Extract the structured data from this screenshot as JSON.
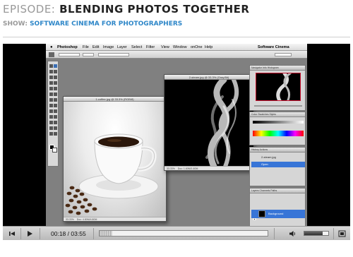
{
  "header": {
    "episode_prefix": "EPISODE:",
    "episode_title": "BLENDING PHOTOS TOGETHER",
    "show_prefix": "SHOW:",
    "show_title": "SOFTWARE CINEMA FOR PHOTOGRAPHERS"
  },
  "video": {
    "menubar": {
      "apple": "",
      "app": "Photoshop",
      "items": [
        "File",
        "Edit",
        "Image",
        "Layer",
        "Select",
        "Filter",
        "View",
        "Window",
        "onOne",
        "Help"
      ],
      "right_label": "Software Cinema"
    },
    "options_bar": {
      "chip_left": "Auto Select",
      "chip_mid": "Group",
      "chip_right": "Show Transform Controls",
      "workspace": "Workspace"
    },
    "doc_coffee": {
      "title": "1-coffee.jpg @ 33.3% (RGB/8)",
      "zoom": "33.33%",
      "doc_info": "Doc: 4.80M/4.80M"
    },
    "doc_steam": {
      "title": "2-steam.jpg @ 33.3% (Gray/8#)",
      "zoom": "33.33%",
      "doc_info": "Doc: 1.60M/1.60M"
    },
    "panels": {
      "navigator_tabs": "Navigator  Info  Histogram",
      "color_tabs": "Color  Swatches  Styles",
      "layers_top_tabs": "History  Actions",
      "history_file": "2-steam.jpg",
      "history_step": "Open",
      "layers_tabs": "Layers  Channels  Paths",
      "layer_name": "Background"
    }
  },
  "controls": {
    "time_current": "00:18",
    "time_separator": "/",
    "time_total": "03:55",
    "progress_fraction": 0.077,
    "volume_fraction": 0.75,
    "play_icon": "play-icon",
    "rewind_icon": "skip-back-icon",
    "mute_icon": "speaker-icon",
    "fullscreen_icon": "fullscreen-icon"
  },
  "colors": {
    "show_accent": "#2d86c8",
    "player_bg": "#000000",
    "photoshop_workspace": "#808080",
    "layer_highlight": "#3875d7"
  }
}
